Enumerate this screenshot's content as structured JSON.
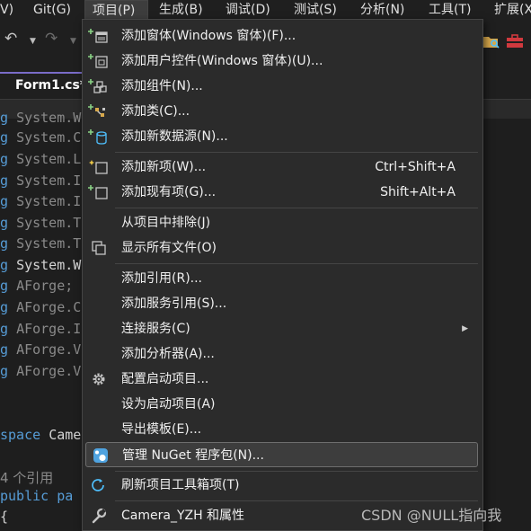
{
  "menubar": {
    "items": [
      "V)",
      "Git(G)",
      "项目(P)",
      "生成(B)",
      "调试(D)",
      "测试(S)",
      "分析(N)",
      "工具(T)",
      "扩展(X"
    ]
  },
  "tabs": {
    "active": "Form1.cs*"
  },
  "code": {
    "using_prefix": "g",
    "lines": [
      "System.W",
      "System.C",
      "System.L",
      "System.I",
      "System.I",
      "System.T",
      "System.T",
      "System.W",
      "AForge;",
      "AForge.C",
      "AForge.I",
      "AForge.V",
      "AForge.V"
    ],
    "namespace_kw": "space",
    "namespace_name": "Came",
    "refcount": "4 个引用",
    "public_kw": "public",
    "partial_frag": "pa",
    "brace": "{"
  },
  "menu": {
    "items": [
      {
        "label": "添加窗体(Windows 窗体)(F)...",
        "shortcut": "",
        "icon": "add-form-icon"
      },
      {
        "label": "添加用户控件(Windows 窗体)(U)...",
        "shortcut": "",
        "icon": "add-user-control-icon"
      },
      {
        "label": "添加组件(N)...",
        "shortcut": "",
        "icon": "add-component-icon"
      },
      {
        "label": "添加类(C)...",
        "shortcut": "",
        "icon": "add-class-icon"
      },
      {
        "label": "添加新数据源(N)...",
        "shortcut": "",
        "icon": "add-data-source-icon"
      },
      {
        "label": "添加新项(W)...",
        "shortcut": "Ctrl+Shift+A",
        "icon": "add-new-item-icon"
      },
      {
        "label": "添加现有项(G)...",
        "shortcut": "Shift+Alt+A",
        "icon": "add-existing-item-icon"
      },
      {
        "label": "从项目中排除(J)",
        "shortcut": "",
        "icon": ""
      },
      {
        "label": "显示所有文件(O)",
        "shortcut": "",
        "icon": "show-all-files-icon"
      },
      {
        "label": "添加引用(R)...",
        "shortcut": "",
        "icon": ""
      },
      {
        "label": "添加服务引用(S)...",
        "shortcut": "",
        "icon": ""
      },
      {
        "label": "连接服务(C)",
        "shortcut": "",
        "icon": ""
      },
      {
        "label": "添加分析器(A)...",
        "shortcut": "",
        "icon": ""
      },
      {
        "label": "配置启动项目...",
        "shortcut": "",
        "icon": "gear-icon"
      },
      {
        "label": "设为启动项目(A)",
        "shortcut": "",
        "icon": ""
      },
      {
        "label": "导出模板(E)...",
        "shortcut": "",
        "icon": ""
      },
      {
        "label": "管理 NuGet 程序包(N)...",
        "shortcut": "",
        "icon": "nuget-icon"
      },
      {
        "label": "刷新项目工具箱项(T)",
        "shortcut": "",
        "icon": "refresh-icon"
      },
      {
        "label": "Camera_YZH 和属性",
        "shortcut": "",
        "icon": "wrench-icon"
      }
    ]
  },
  "watermark": "CSDN @NULL指向我",
  "colors": {
    "background": "#1f1f1f",
    "menu_bg": "#2b2b2b",
    "highlight": "#3d3d3d",
    "keyword": "#569cd6",
    "tab_accent": "#7a6cc9",
    "icon_green": "#89d185",
    "icon_blue": "#4fc1ff"
  }
}
